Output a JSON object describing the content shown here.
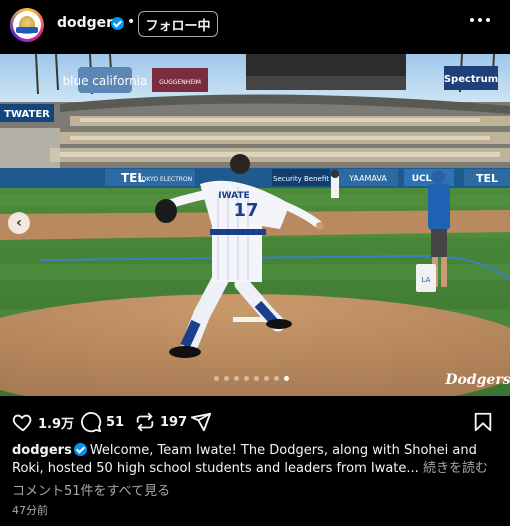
{
  "header": {
    "username": "dodgers",
    "separator": "•",
    "follow_label": "フォロー中",
    "avatar_icon": "dodgers-trophy-avatar-icon",
    "more_icon": "more-options-icon"
  },
  "photo": {
    "jersey_name": "IWATE",
    "jersey_number": "17",
    "signage": {
      "blue_shield": "blue california",
      "guggenheim": "GUGGENHEIM",
      "spectrum": "Spectrum",
      "left_banner": "TWATER",
      "tel": "TEL",
      "tel_sub": "TOKYO ELECTRON",
      "security": "Security Benefit",
      "yaamava": "YAAMAVA",
      "ucla": "UCLA",
      "tel_right": "TEL",
      "bucket": "LA"
    },
    "watermark": "Dodgers",
    "carousel_total": 8,
    "carousel_active_index": 7
  },
  "actions": {
    "likes": "1.9万",
    "comments": "51",
    "reposts": "197"
  },
  "caption": {
    "username": "dodgers",
    "text": "Welcome, Team Iwate! The Dodgers, along with Shohei and Roki, hosted 50 high school students and leaders from Iwate...",
    "more_label": "続きを読む"
  },
  "comments_link": "コメント51件をすべて見る",
  "timestamp": "47分前",
  "colors": {
    "background": "#000000",
    "verified": "#0095f6",
    "secondary_text": "#a8a8a8",
    "dodger_blue": "#005a9c"
  }
}
